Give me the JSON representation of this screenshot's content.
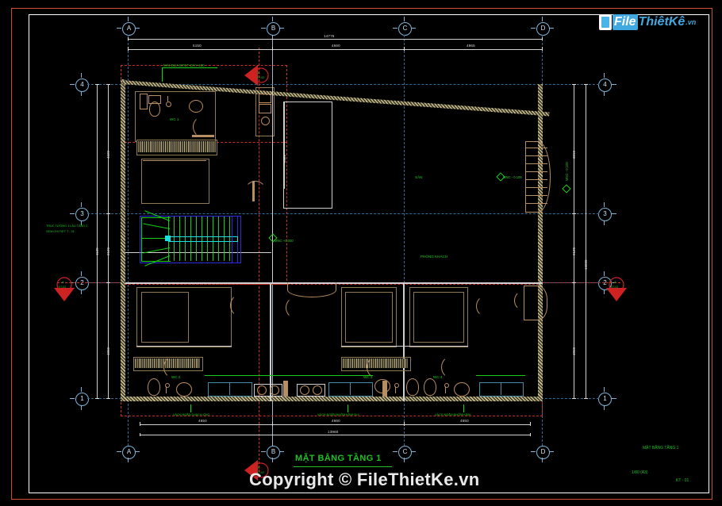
{
  "drawing": {
    "title": "MẶT BẰNG TẦNG 1",
    "sheet_code": "KT - 01",
    "scale": "1/80  (A3)",
    "titleblock_name": "MẶT BẰNG TẦNG 1"
  },
  "watermark": {
    "copyright": "Copyright © FileThietKe.vn",
    "logo_part1": "File",
    "logo_part2": "ThiêtKê",
    "logo_part3": ".vn"
  },
  "grid": {
    "columns": [
      "A",
      "B",
      "C",
      "D"
    ],
    "rows": [
      "1",
      "2",
      "3",
      "4"
    ]
  },
  "dimensions": {
    "top_total": "14775",
    "top_segments": [
      "5150",
      "4660",
      "4965"
    ],
    "bottom_total": "13960",
    "bottom_segments": [
      "4650",
      "4660",
      "4650"
    ],
    "left_segments": [
      "4620",
      "2120",
      "4860"
    ],
    "left_small": "1120",
    "right_segments": [
      "3810",
      "2120",
      "4860"
    ],
    "right_total": "10800",
    "interior_v1": "2480"
  },
  "labels": {
    "wc1": "WC 1",
    "wc2": "WC 2",
    "wc3": "WC 3",
    "wc4": "WC 4",
    "center_room": "SÂN",
    "lower_center": "PHÒNG KHÁCH",
    "top_note": "MÁI ĐUA BTCT DÀY 100",
    "left_note_1": "TRỤC TƯỜNG 1 LẦU TẦNG 2",
    "left_note_2": "XEM CHI TIẾT T - 01",
    "elev_center": "MNC +0,000",
    "elev_right": "MNC - 0,100",
    "bottom_note_1": "VÁCH NGĂN THẠCH CAO",
    "bottom_note_2": "VÁCH NGĂN NHÔM KÍNH 5LY",
    "bottom_note_3": "VÁCH NGĂN NHÔM KÍNH"
  },
  "section_markers": {
    "top": {
      "name": "B",
      "sheet": "KT-02"
    },
    "bottom": {
      "name": "B",
      "sheet": "KT-02"
    },
    "left": {
      "name": "A",
      "sheet": "KT-02"
    },
    "right": {
      "name": "A",
      "sheet": "KT-02"
    }
  },
  "colors": {
    "background": "#000000",
    "paper_border": "#d04a2a",
    "grid_blue": "#2e6c96",
    "green_text": "#18d018",
    "red_marker": "#cc2222",
    "wall": "#9a9a9a",
    "dimension": "#dedede",
    "logo_blue": "#3fa9e0"
  }
}
